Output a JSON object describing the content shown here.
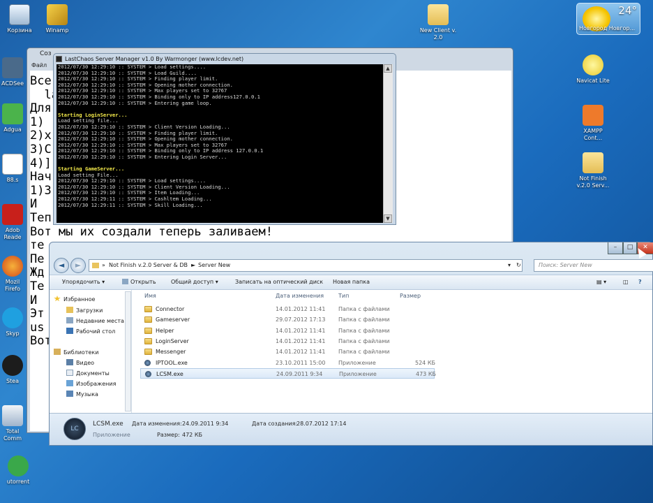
{
  "desktop": {
    "icons": [
      {
        "id": "recycle",
        "label": "Корзина",
        "color": "#cfe3f4"
      },
      {
        "id": "winamp",
        "label": "Winamp",
        "color": "#f0c43a"
      },
      {
        "id": "newclient",
        "label": "New Client v.\n2.0",
        "color": "#f2d47a"
      },
      {
        "id": "navicat",
        "label": "Navicat Lite",
        "color": "#f3e36b"
      },
      {
        "id": "xampp",
        "label": "XAMPP\nCont...",
        "color": "#f07b2a"
      },
      {
        "id": "notfinish",
        "label": "Not Finish\nv.2.0 Serv...",
        "color": "#f2d47a"
      },
      {
        "id": "acdsee",
        "label": "ACDSee",
        "color": "#4a6a8a"
      },
      {
        "id": "adguard",
        "label": "Adgua",
        "color": "#4bb34b"
      },
      {
        "id": "file88",
        "label": "88.s",
        "color": "#ffffff"
      },
      {
        "id": "adobe",
        "label": "Adob\nReade",
        "color": "#c8201b"
      },
      {
        "id": "firefox",
        "label": "Mozil\nFirefo",
        "color": "#e06f1e"
      },
      {
        "id": "skype",
        "label": "Skyp",
        "color": "#1fa0e0"
      },
      {
        "id": "steam",
        "label": "Stea",
        "color": "#1c1c1c"
      },
      {
        "id": "totalcmd",
        "label": "Total\nComm",
        "color": "#d6dfea"
      },
      {
        "id": "utorrent",
        "label": "utorrent",
        "color": "#3aa84a"
      }
    ]
  },
  "weather": {
    "temp": "24°",
    "city": "Новгород Новгор..."
  },
  "notepad": {
    "title": "Соз",
    "menu": "Файл",
    "lines": [
      "Все                                       сервер",
      "  la",
      "Для",
      "1)",
      "2)x",
      "3)C",
      "4)]                                        идео!",
      "Нач",
      "1)З",
      "И",
      "Теп",
      "Вот мы их создали теперь заливаем!",
      "те",
      "Пе",
      "Жд",
      "Те",
      "И",
      "Эт",
      "us",
      "Вот"
    ]
  },
  "console": {
    "title": "LastChaos Server Manager v1.0 By Warmonger (www.lcdev.net)",
    "lines": [
      {
        "t": "2012/07/30 12:29:10 :: SYSTEM > Load settings....",
        "hl": false
      },
      {
        "t": "2012/07/30 12:29:10 :: SYSTEM > Load Guild....",
        "hl": false
      },
      {
        "t": "2012/07/30 12:29:10 :: SYSTEM > Finding player limit.",
        "hl": false
      },
      {
        "t": "2012/07/30 12:29:10 :: SYSTEM > Opening mother connection.",
        "hl": false
      },
      {
        "t": "2012/07/30 12:29:10 :: SYSTEM > Max players set to 32767",
        "hl": false
      },
      {
        "t": "2012/07/30 12:29:10 :: SYSTEM > Binding only to IP address127.0.0.1",
        "hl": false
      },
      {
        "t": "2012/07/30 12:29:10 :: SYSTEM > Entering game loop.",
        "hl": false
      },
      {
        "t": "",
        "hl": false
      },
      {
        "t": "Starting LoginServer...",
        "hl": true
      },
      {
        "t": "Load setting file...",
        "hl": false
      },
      {
        "t": "2012/07/30 12:29:10 :: SYSTEM > Client Version Loading...",
        "hl": false
      },
      {
        "t": "2012/07/30 12:29:10 :: SYSTEM > Finding player limit.",
        "hl": false
      },
      {
        "t": "2012/07/30 12:29:10 :: SYSTEM > Opening mother connection.",
        "hl": false
      },
      {
        "t": "2012/07/30 12:29:10 :: SYSTEM > Max players set to 32767",
        "hl": false
      },
      {
        "t": "2012/07/30 12:29:10 :: SYSTEM > Binding only to IP address 127.0.0.1",
        "hl": false
      },
      {
        "t": "2012/07/30 12:29:10 :: SYSTEM > Entering Login Server...",
        "hl": false
      },
      {
        "t": "",
        "hl": false
      },
      {
        "t": "Starting GameServer...",
        "hl": true
      },
      {
        "t": "Load setting File...",
        "hl": false
      },
      {
        "t": "2012/07/30 12:29:10 :: SYSTEM > Load settings....",
        "hl": false
      },
      {
        "t": "2012/07/30 12:29:10 :: SYSTEM > Client Version Loading...",
        "hl": false
      },
      {
        "t": "2012/07/30 12:29:10 :: SYSTEM > Item Loading...",
        "hl": false
      },
      {
        "t": "2012/07/30 12:29:11 :: SYSTEM > Cashltem Loading...",
        "hl": false
      },
      {
        "t": "2012/07/30 12:29:11 :: SYSTEM > Skill Loading...",
        "hl": false
      }
    ]
  },
  "explorer": {
    "breadcrumb": [
      "Not Finish v.2.0 Server & DB",
      "Server New"
    ],
    "search_placeholder": "Поиск: Server New",
    "toolbar": [
      "Упорядочить ▾",
      "Открыть",
      "Общий доступ ▾",
      "Записать на оптический диск",
      "Новая папка"
    ],
    "nav": {
      "favorites": "Избранное",
      "downloads": "Загрузки",
      "recent": "Недавние места",
      "desktop": "Рабочий стол",
      "libraries": "Библиотеки",
      "video": "Видео",
      "documents": "Документы",
      "images": "Изображения",
      "music": "Музыка"
    },
    "columns": {
      "name": "Имя",
      "date": "Дата изменения",
      "type": "Тип",
      "size": "Размер"
    },
    "rows": [
      {
        "name": "Connector",
        "date": "14.01.2012 11:41",
        "type": "Папка с файлами",
        "size": "",
        "kind": "folder"
      },
      {
        "name": "Gameserver",
        "date": "29.07.2012 17:13",
        "type": "Папка с файлами",
        "size": "",
        "kind": "folder"
      },
      {
        "name": "Helper",
        "date": "14.01.2012 11:41",
        "type": "Папка с файлами",
        "size": "",
        "kind": "folder"
      },
      {
        "name": "LoginServer",
        "date": "14.01.2012 11:41",
        "type": "Папка с файлами",
        "size": "",
        "kind": "folder"
      },
      {
        "name": "Messenger",
        "date": "14.01.2012 11:41",
        "type": "Папка с файлами",
        "size": "",
        "kind": "folder"
      },
      {
        "name": "IPTOOL.exe",
        "date": "23.10.2011 15:00",
        "type": "Приложение",
        "size": "524 КБ",
        "kind": "exe"
      },
      {
        "name": "LCSM.exe",
        "date": "24.09.2011 9:34",
        "type": "Приложение",
        "size": "473 КБ",
        "kind": "exe"
      }
    ],
    "details": {
      "name": "LCSM.exe",
      "kind": "Приложение",
      "modified_label": "Дата изменения:",
      "modified": "24.09.2011 9:34",
      "created_label": "Дата создания:",
      "created": "28.07.2012 17:14",
      "size_label": "Размер:",
      "size": "472 КБ",
      "icon_text": "LC"
    }
  }
}
